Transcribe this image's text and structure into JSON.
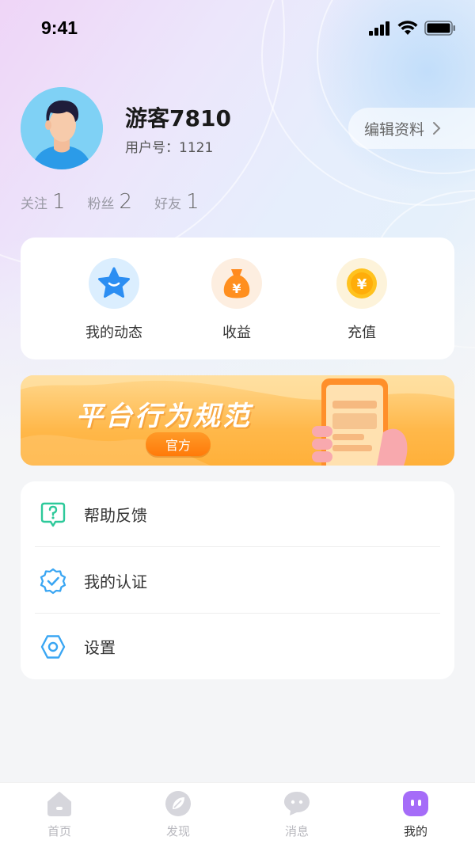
{
  "status_bar": {
    "time": "9:41"
  },
  "profile": {
    "username": "游客7810",
    "user_id_label": "用户号：1121",
    "edit_label": "编辑资料"
  },
  "stats": [
    {
      "label": "关注",
      "value": "1"
    },
    {
      "label": "粉丝",
      "value": "2"
    },
    {
      "label": "好友",
      "value": "1"
    }
  ],
  "quick_actions": [
    {
      "label": "我的动态",
      "icon": "star-icon",
      "bg": "#dbeefe"
    },
    {
      "label": "收益",
      "icon": "money-bag-icon",
      "bg": "#fdeee0"
    },
    {
      "label": "充值",
      "icon": "yen-coin-icon",
      "bg": "#fdf3da"
    }
  ],
  "banner": {
    "title": "平台行为规范",
    "tag": "官方"
  },
  "menu": [
    {
      "label": "帮助反馈",
      "icon": "help-feedback-icon"
    },
    {
      "label": "我的认证",
      "icon": "verified-badge-icon"
    },
    {
      "label": "设置",
      "icon": "settings-icon"
    }
  ],
  "tab_bar": [
    {
      "label": "首页",
      "icon": "home-icon",
      "active": false
    },
    {
      "label": "发现",
      "icon": "compass-icon",
      "active": false
    },
    {
      "label": "消息",
      "icon": "chat-icon",
      "active": false
    },
    {
      "label": "我的",
      "icon": "profile-face-icon",
      "active": true
    }
  ],
  "colors": {
    "accent": "#a56cf8",
    "tab_inactive": "#d6d6dc",
    "menu_green": "#2dc99a",
    "menu_blue": "#3aa6f3"
  }
}
